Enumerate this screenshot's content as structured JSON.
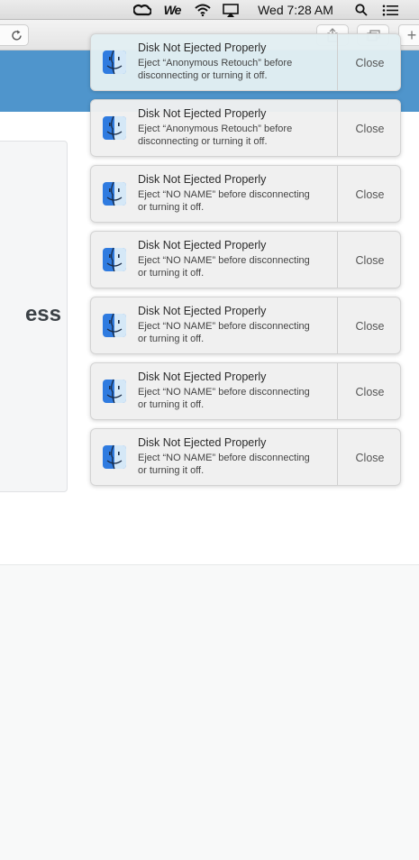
{
  "menubar": {
    "icons": [
      "creative-cloud-icon",
      "we-app-icon",
      "wifi-icon",
      "airplay-icon",
      "spotlight-search-icon",
      "notification-center-icon"
    ],
    "we_label": "We",
    "clock": "Wed 7:28 AM"
  },
  "browser": {
    "icons": [
      "reload-icon",
      "share-icon",
      "tabs-overview-icon",
      "new-tab-icon"
    ],
    "newtab_glyph": "+"
  },
  "page": {
    "heading_fragment": "ess",
    "colors": {
      "hero_band": "#4f95cc"
    }
  },
  "notifications": [
    {
      "title": "Disk Not Ejected Properly",
      "line1": "Eject “Anonymous Retouch” before",
      "line2": "disconnecting or turning it off.",
      "action": "Close",
      "icon": "finder-icon",
      "highlighted": true
    },
    {
      "title": "Disk Not Ejected Properly",
      "line1": "Eject “Anonymous Retouch” before",
      "line2": "disconnecting or turning it off.",
      "action": "Close",
      "icon": "finder-icon"
    },
    {
      "title": "Disk Not Ejected Properly",
      "line1": "Eject “NO NAME” before disconnecting",
      "line2": "or turning it off.",
      "action": "Close",
      "icon": "finder-icon"
    },
    {
      "title": "Disk Not Ejected Properly",
      "line1": "Eject “NO NAME” before disconnecting",
      "line2": "or turning it off.",
      "action": "Close",
      "icon": "finder-icon"
    },
    {
      "title": "Disk Not Ejected Properly",
      "line1": "Eject “NO NAME” before disconnecting",
      "line2": "or turning it off.",
      "action": "Close",
      "icon": "finder-icon"
    },
    {
      "title": "Disk Not Ejected Properly",
      "line1": "Eject “NO NAME” before disconnecting",
      "line2": "or turning it off.",
      "action": "Close",
      "icon": "finder-icon"
    },
    {
      "title": "Disk Not Ejected Properly",
      "line1": "Eject “NO NAME” before disconnecting",
      "line2": "or turning it off.",
      "action": "Close",
      "icon": "finder-icon"
    }
  ]
}
